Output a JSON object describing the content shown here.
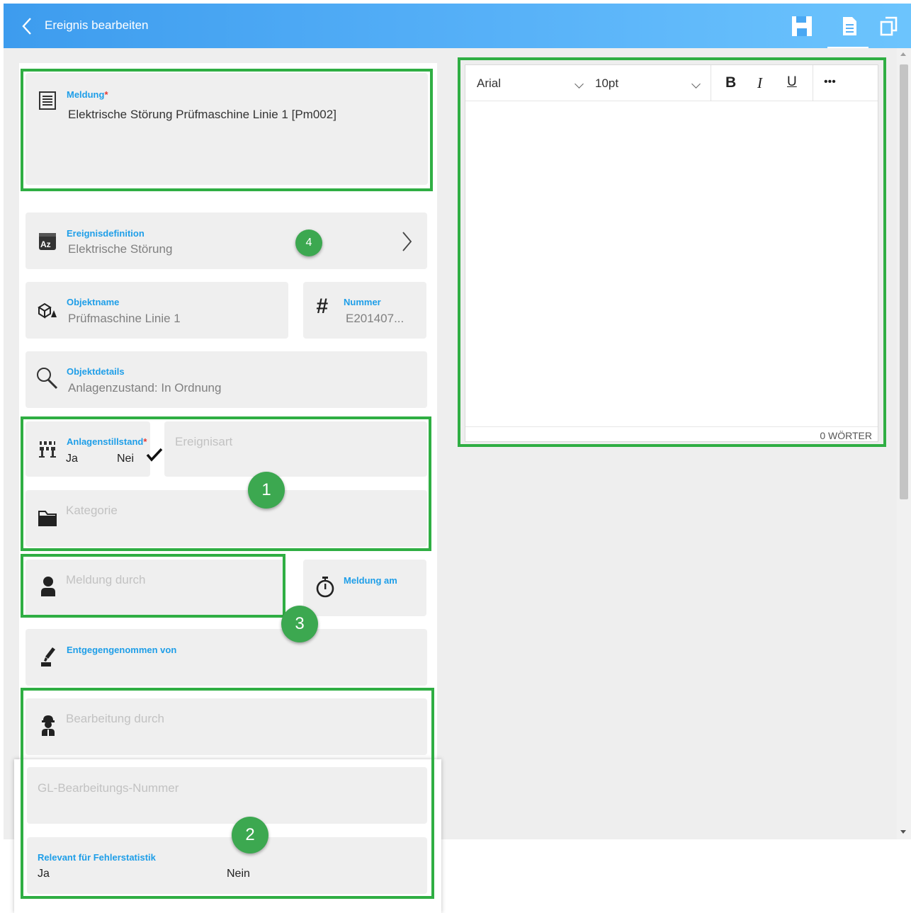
{
  "header": {
    "title": "Ereignis bearbeiten",
    "actions": [
      "save-icon",
      "document-icon",
      "copy-icon"
    ],
    "accent_color": "#57b1f8"
  },
  "form": {
    "meldung": {
      "label": "Meldung",
      "required_mark": "*",
      "value": "Elektrische Störung Prüfmaschine Linie 1 [Pm002]"
    },
    "ereignisdefinition": {
      "label": "Ereignisdefinition",
      "value": "Elektrische Störung"
    },
    "objektname": {
      "label": "Objektname",
      "value": "Prüfmaschine Linie 1"
    },
    "nummer": {
      "label": "Nummer",
      "value": "E201407..."
    },
    "objektdetails": {
      "label": "Objektdetails",
      "value": "Anlagenzustand: In Ordnung"
    },
    "anlagenstillstand": {
      "label": "Anlagenstillstand",
      "required_mark": "*",
      "option_yes": "Ja",
      "option_no": "Nei",
      "selected": "Nein"
    },
    "ereignisart": {
      "placeholder": "Ereignisart"
    },
    "kategorie": {
      "placeholder": "Kategorie"
    },
    "meldung_durch": {
      "placeholder": "Meldung durch"
    },
    "meldung_am": {
      "label": "Meldung am"
    },
    "entgegengenommen_von": {
      "label": "Entgegengenommen von"
    },
    "bearbeitung_durch": {
      "placeholder": "Bearbeitung durch"
    },
    "gl_nummer": {
      "placeholder": "GL-Bearbeitungs-Nummer"
    },
    "relevant": {
      "label": "Relevant für Fehlerstatistik",
      "option_yes": "Ja",
      "option_no": "Nein"
    }
  },
  "editor": {
    "font": "Arial",
    "size": "10pt",
    "bold": "B",
    "italic": "I",
    "underline": "U",
    "more": "•••",
    "word_count": "0 WÖRTER"
  },
  "annotations": {
    "badge_1": "1",
    "badge_2": "2",
    "badge_3": "3",
    "badge_4": "4",
    "highlight_color": "#2fae43"
  }
}
